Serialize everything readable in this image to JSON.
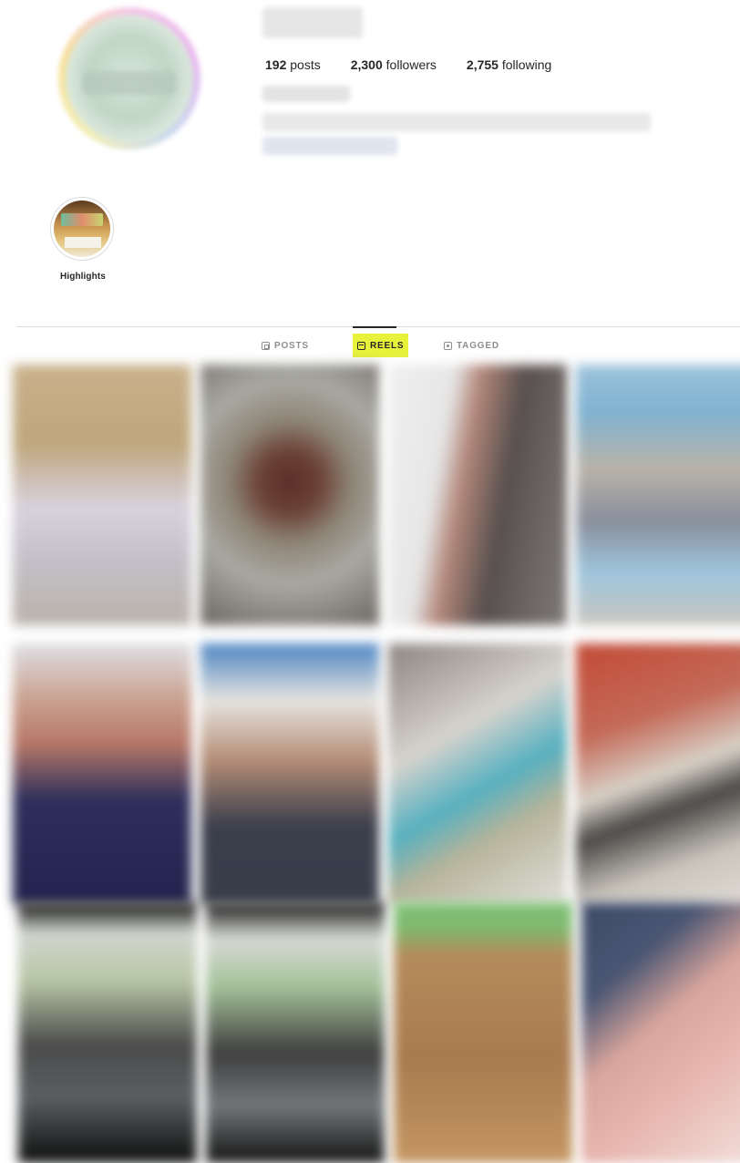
{
  "profile": {
    "stats": [
      {
        "count": "192",
        "label": "posts"
      },
      {
        "count": "2,300",
        "label": "followers"
      },
      {
        "count": "2,755",
        "label": "following"
      }
    ]
  },
  "highlights": [
    {
      "label": "Highlights"
    }
  ],
  "tabs": [
    {
      "label": "POSTS",
      "active": false
    },
    {
      "label": "REELS",
      "active": true
    },
    {
      "label": "TAGGED",
      "active": false
    }
  ],
  "colors": {
    "active_tab_highlight": "#e7f23b",
    "text_primary": "#262626",
    "text_secondary": "#8e8e8e",
    "divider": "#dbdbdb"
  },
  "reels_grid": {
    "rows": 3,
    "columns": 4
  }
}
